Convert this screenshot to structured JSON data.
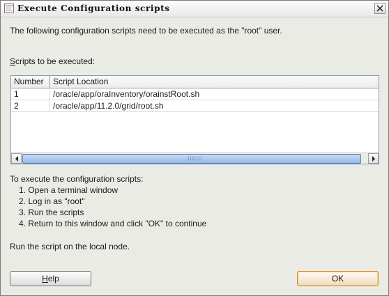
{
  "window": {
    "title": "Execute Configuration scripts"
  },
  "intro": "The following configuration scripts need to be executed as the \"root\" user.",
  "scripts_label_key": "S",
  "scripts_label_rest": "cripts to be executed:",
  "table": {
    "columns": [
      "Number",
      "Script Location"
    ],
    "rows": [
      {
        "number": "1",
        "location": "/oracle/app/oraInventory/orainstRoot.sh"
      },
      {
        "number": "2",
        "location": "/oracle/app/11.2.0/grid/root.sh"
      }
    ]
  },
  "instructions": {
    "heading": "To execute the configuration scripts:",
    "steps": [
      "1. Open a terminal window",
      "2. Log in as \"root\"",
      "3. Run the scripts",
      "4. Return to this window and click \"OK\" to continue"
    ]
  },
  "note": "Run the script on the local node.",
  "buttons": {
    "help_key": "H",
    "help_rest": "elp",
    "ok": "OK"
  },
  "icons": [
    "window-icon",
    "close-icon",
    "scroll-left-icon",
    "scroll-right-icon"
  ]
}
